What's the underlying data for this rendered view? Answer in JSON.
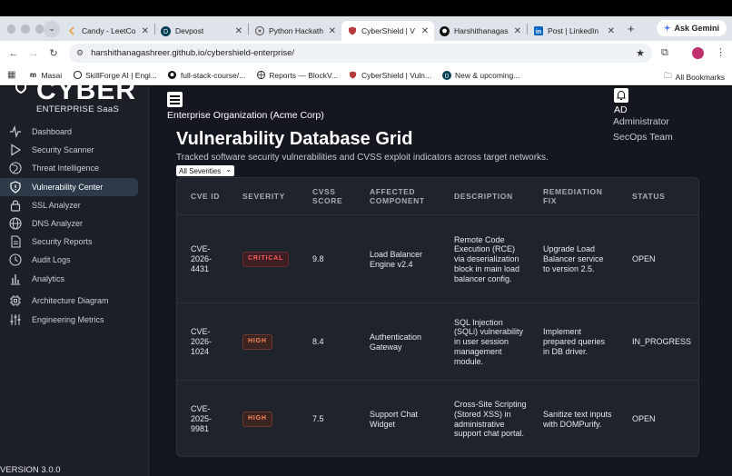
{
  "browser": {
    "tabs": [
      {
        "label": "Candy - LeetCo",
        "icon": "leetcode-icon",
        "active": false
      },
      {
        "label": "Devpost",
        "icon": "devpost-icon",
        "active": false
      },
      {
        "label": "Python Hackath",
        "icon": "python-icon",
        "active": false
      },
      {
        "label": "CyberShield | V",
        "icon": "cybershield-icon",
        "active": true
      },
      {
        "label": "Harshithanagas",
        "icon": "github-icon",
        "active": false
      },
      {
        "label": "Post | LinkedIn",
        "icon": "linkedin-icon",
        "active": false
      }
    ],
    "ask_gemini": "Ask Gemini",
    "url": "harshithanagashreer.github.io/cybershield-enterprise/",
    "bookmarks": [
      {
        "label": "Masai",
        "icon": "masai-icon"
      },
      {
        "label": "SkillForge AI | Engi...",
        "icon": "skillforge-icon"
      },
      {
        "label": "full-stack-course/...",
        "icon": "github-icon"
      },
      {
        "label": "Reports — BlockV...",
        "icon": "globe-icon"
      },
      {
        "label": "CyberShield | Vuln...",
        "icon": "cybershield-icon"
      },
      {
        "label": "New & upcoming...",
        "icon": "devpost-icon"
      }
    ],
    "all_bookmarks": "All Bookmarks"
  },
  "sidebar": {
    "logo_text": "CYBER",
    "subtitle": "ENTERPRISE SaaS",
    "items": [
      {
        "label": "Dashboard",
        "icon": "activity-icon",
        "active": false
      },
      {
        "label": "Security Scanner",
        "icon": "play-icon",
        "active": false
      },
      {
        "label": "Threat Intelligence",
        "icon": "globe-icon",
        "active": false
      },
      {
        "label": "Vulnerability Center",
        "icon": "shield-alert-icon",
        "active": true
      },
      {
        "label": "SSL Analyzer",
        "icon": "lock-icon",
        "active": false
      },
      {
        "label": "DNS Analyzer",
        "icon": "globe-icon",
        "active": false
      },
      {
        "label": "Security Reports",
        "icon": "document-icon",
        "active": false
      },
      {
        "label": "Audit Logs",
        "icon": "clock-icon",
        "active": false
      },
      {
        "label": "Analytics",
        "icon": "bar-chart-icon",
        "active": false
      },
      {
        "label": "Architecture Diagram",
        "icon": "cpu-icon",
        "active": false
      },
      {
        "label": "Engineering Metrics",
        "icon": "sliders-icon",
        "active": false
      }
    ],
    "version": "VERSION 3.0.0"
  },
  "header": {
    "organization": "Enterprise Organization (Acme Corp)",
    "user_initials": "AD",
    "user_role": "Administrator",
    "user_team": "SecOps Team"
  },
  "page": {
    "title": "Vulnerability Database Grid",
    "subtitle": "Tracked software security vulnerabilities and CVSS exploit indicators across target networks.",
    "filter_value": "All Severities"
  },
  "table": {
    "columns": [
      "CVE ID",
      "SEVERITY",
      "CVSS SCORE",
      "AFFECTED COMPONENT",
      "DESCRIPTION",
      "REMEDIATION FIX",
      "STATUS"
    ],
    "rows": [
      {
        "cve": "CVE-2026-4431",
        "severity": "CRITICAL",
        "cvss": "9.8",
        "component": "Load Balancer Engine v2.4",
        "description": "Remote Code Execution (RCE) via deserialization block in main load balancer config.",
        "fix": "Upgrade Load Balancer service to version 2.5.",
        "status": "OPEN"
      },
      {
        "cve": "CVE-2026-1024",
        "severity": "HIGH",
        "cvss": "8.4",
        "component": "Authentication Gateway",
        "description": "SQL Injection (SQLi) vulnerability in user session management module.",
        "fix": "Implement prepared queries in DB driver.",
        "status": "IN_PROGRESS"
      },
      {
        "cve": "CVE-2025-9981",
        "severity": "HIGH",
        "cvss": "7.5",
        "component": "Support Chat Widget",
        "description": "Cross-Site Scripting (Stored XSS) in administrative support chat portal.",
        "fix": "Sanitize text inputs with DOMPurify.",
        "status": "OPEN"
      }
    ]
  }
}
